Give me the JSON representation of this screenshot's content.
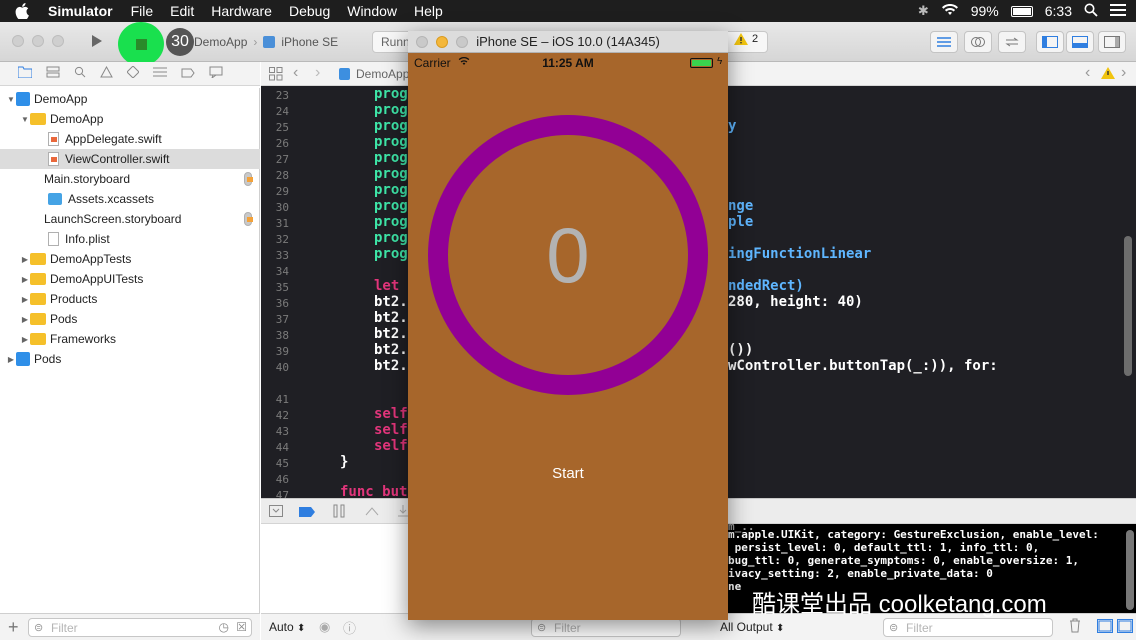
{
  "menubar": {
    "app": "Simulator",
    "items": [
      "File",
      "Edit",
      "Hardware",
      "Debug",
      "Window",
      "Help"
    ],
    "battery": "99%",
    "time": "6:33"
  },
  "toolbar": {
    "badge": "30",
    "scheme_app": "DemoApp",
    "scheme_device": "iPhone SE",
    "status": "Runni",
    "warnings": "2"
  },
  "navigator": {
    "tree": [
      {
        "label": "DemoApp",
        "kind": "project",
        "indent": 0,
        "open": true
      },
      {
        "label": "DemoApp",
        "kind": "folder",
        "indent": 1,
        "open": true
      },
      {
        "label": "AppDelegate.swift",
        "kind": "swift",
        "indent": 2
      },
      {
        "label": "ViewController.swift",
        "kind": "swift",
        "indent": 2,
        "selected": true
      },
      {
        "label": "Main.storyboard",
        "kind": "storyboard",
        "indent": 2
      },
      {
        "label": "Assets.xcassets",
        "kind": "assets",
        "indent": 2
      },
      {
        "label": "LaunchScreen.storyboard",
        "kind": "storyboard",
        "indent": 2
      },
      {
        "label": "Info.plist",
        "kind": "plist",
        "indent": 2
      },
      {
        "label": "DemoAppTests",
        "kind": "folder",
        "indent": 1
      },
      {
        "label": "DemoAppUITests",
        "kind": "folder",
        "indent": 1
      },
      {
        "label": "Products",
        "kind": "folder",
        "indent": 1
      },
      {
        "label": "Pods",
        "kind": "folder",
        "indent": 1
      },
      {
        "label": "Frameworks",
        "kind": "folder",
        "indent": 1
      },
      {
        "label": "Pods",
        "kind": "project",
        "indent": 0
      }
    ],
    "filter_placeholder": "Filter"
  },
  "jumpbar": {
    "file": "DemoApp"
  },
  "editor": {
    "line_numbers": [
      "23",
      "24",
      "25",
      "26",
      "27",
      "28",
      "29",
      "30",
      "31",
      "32",
      "33",
      "34",
      "35",
      "36",
      "37",
      "38",
      "39",
      "40",
      "",
      "41",
      "42",
      "43",
      "44",
      "45",
      "46",
      "47"
    ],
    "left_code": [
      {
        "line": "23",
        "text": "prog",
        "color": "#3ee6a8"
      },
      {
        "line": "24",
        "text": "prog",
        "color": "#3ee6a8"
      },
      {
        "line": "25",
        "text": "prog",
        "color": "#3ee6a8"
      },
      {
        "line": "26",
        "text": "prog",
        "color": "#3ee6a8"
      },
      {
        "line": "27",
        "text": "prog",
        "color": "#3ee6a8"
      },
      {
        "line": "28",
        "text": "prog",
        "color": "#3ee6a8"
      },
      {
        "line": "29",
        "text": "prog",
        "color": "#3ee6a8"
      },
      {
        "line": "30",
        "text": "prog",
        "color": "#3ee6a8"
      },
      {
        "line": "31",
        "text": "prog",
        "color": "#3ee6a8"
      },
      {
        "line": "32",
        "text": "prog",
        "color": "#3ee6a8"
      },
      {
        "line": "33",
        "text": "prog",
        "color": "#3ee6a8"
      },
      {
        "line": "35",
        "text": "let",
        "color": "#e2357b"
      },
      {
        "line": "36",
        "text": "bt2.",
        "color": "#ffffff"
      },
      {
        "line": "37",
        "text": "bt2.",
        "color": "#ffffff"
      },
      {
        "line": "38",
        "text": "bt2.",
        "color": "#ffffff"
      },
      {
        "line": "39",
        "text": "bt2.",
        "color": "#ffffff"
      },
      {
        "line": "40",
        "text": "bt2.",
        "color": "#ffffff"
      },
      {
        "line": "42",
        "text": "self",
        "color": "#e2357b"
      },
      {
        "line": "43",
        "text": "self",
        "color": "#e2357b"
      },
      {
        "line": "44",
        "text": "self",
        "color": "#e2357b"
      }
    ],
    "brace": "}",
    "func_text": "func but",
    "right_code": [
      {
        "text": "y",
        "color": "#5fb6ff"
      },
      {
        "text": "nge",
        "color": "#5fb6ff"
      },
      {
        "text": "ple",
        "color": "#5fb6ff"
      },
      {
        "text": "ingFunctionLinear",
        "color": "#5fb6ff"
      },
      {
        "text": "ndedRect)",
        "color": "#5fb6ff"
      },
      {
        "text": "280, height: 40)",
        "color": "#ffffff"
      },
      {
        "text": "())",
        "color": "#ffffff"
      },
      {
        "text": "wController.buttonTap(_:)), for:",
        "color": "#ffffff"
      }
    ]
  },
  "console": {
    "lines": [
      "m.apple.UIKit, category: GestureExclusion, enable_level:",
      " persist_level: 0, default_ttl: 1, info_ttl: 0,",
      "bug_ttl: 0, generate_symptoms: 0, enable_oversize: 1,",
      "ivacy_setting: 2, enable_private_data: 0",
      "ne"
    ]
  },
  "bottombar": {
    "auto": "Auto",
    "filter_placeholder": "Filter",
    "all_output": "All Output",
    "filter2_placeholder": "Filter"
  },
  "simulator": {
    "title": "iPhone SE – iOS 10.0 (14A345)",
    "carrier": "Carrier",
    "time": "11:25 AM",
    "counter": "0",
    "start": "Start",
    "ring_color": "#920095",
    "bg_color": "#a7662b"
  },
  "watermark": "酷课堂出品 coolketang.com"
}
